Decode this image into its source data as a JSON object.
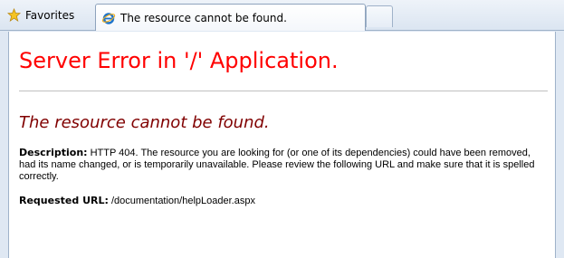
{
  "browser": {
    "favorites_label": "Favorites",
    "tab_title": "The resource cannot be found."
  },
  "page": {
    "heading": "Server Error in '/' Application.",
    "subheading": "The resource cannot be found.",
    "description_label": "Description:",
    "description_text": "HTTP 404. The resource you are looking for (or one of its dependencies) could have been removed, had its name changed, or is temporarily unavailable.  Please review the following URL and make sure that it is spelled correctly.",
    "url_label": "Requested URL:",
    "url_value": "/documentation/helpLoader.aspx"
  },
  "colors": {
    "heading": "#ff0000",
    "subheading": "#800000"
  },
  "icons": [
    "star-icon",
    "ie-icon"
  ]
}
